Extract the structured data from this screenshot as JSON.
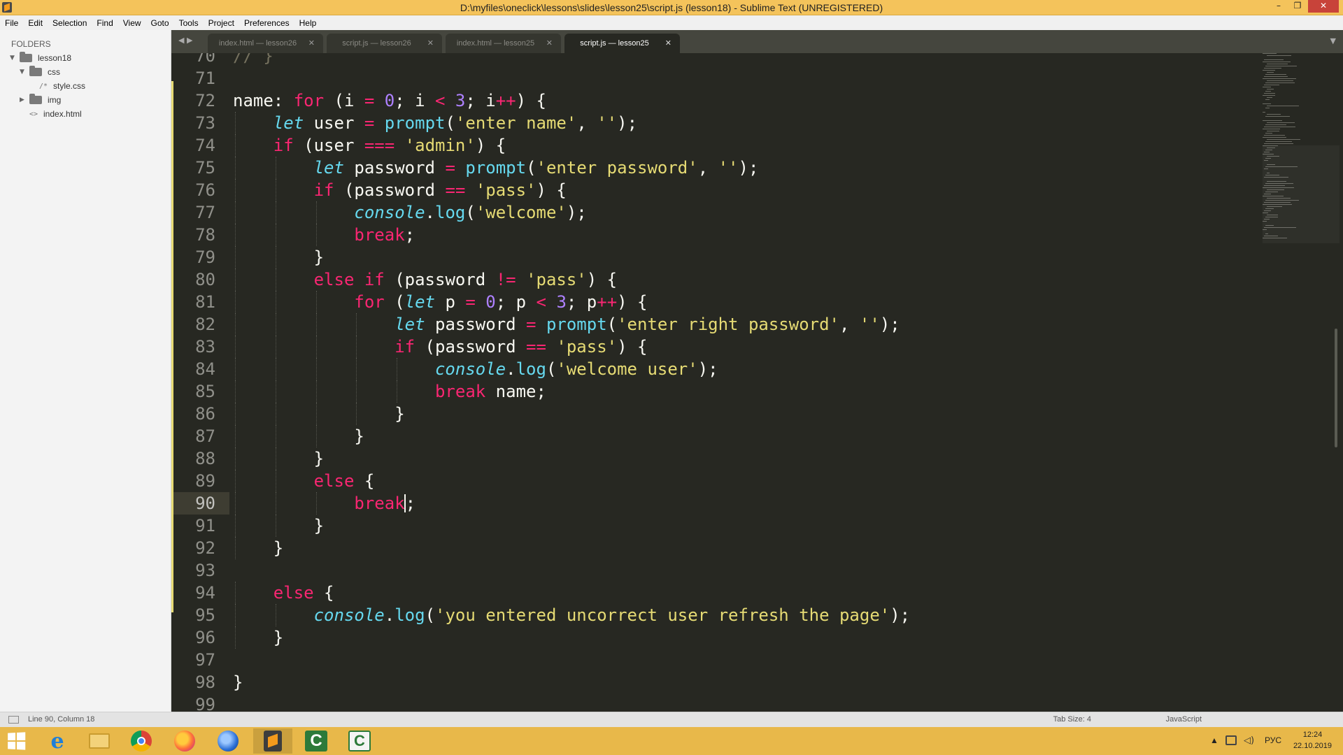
{
  "window": {
    "title": "D:\\myfiles\\oneclick\\lessons\\slides\\lesson25\\script.js (lesson18) - Sublime Text (UNREGISTERED)",
    "minimize_glyph": "–",
    "maximize_glyph": "❐",
    "close_glyph": "✕"
  },
  "menu": [
    "File",
    "Edit",
    "Selection",
    "Find",
    "View",
    "Goto",
    "Tools",
    "Project",
    "Preferences",
    "Help"
  ],
  "sidebar": {
    "heading": "FOLDERS",
    "tree": [
      {
        "label": "lesson18",
        "type": "folder",
        "expanded": true
      },
      {
        "label": "css",
        "type": "folder",
        "expanded": true
      },
      {
        "label": "style.css",
        "type": "file",
        "icon": "/*"
      },
      {
        "label": "img",
        "type": "folder",
        "expanded": false
      },
      {
        "label": "index.html",
        "type": "file",
        "icon": "<>"
      }
    ]
  },
  "tabs": [
    {
      "label": "index.html — lesson26",
      "active": false
    },
    {
      "label": "script.js — lesson26",
      "active": false
    },
    {
      "label": "index.html — lesson25",
      "active": false
    },
    {
      "label": "script.js — lesson25",
      "active": true
    }
  ],
  "tab_close_glyph": "✕",
  "tab_nav_glyph": "◀ ▶",
  "tab_dropdown_glyph": "▼",
  "editor": {
    "current_line": 90,
    "lines": [
      {
        "n": "70",
        "text": "// }"
      },
      {
        "n": "71",
        "text": ""
      },
      {
        "n": "72",
        "text": "name: for (i = 0; i < 3; i++) {"
      },
      {
        "n": "73",
        "text": "    let user = prompt('enter name', '');"
      },
      {
        "n": "74",
        "text": "    if (user === 'admin') {"
      },
      {
        "n": "75",
        "text": "        let password = prompt('enter password', '');"
      },
      {
        "n": "76",
        "text": "        if (password == 'pass') {"
      },
      {
        "n": "77",
        "text": "            console.log('welcome');"
      },
      {
        "n": "78",
        "text": "            break;"
      },
      {
        "n": "79",
        "text": "        }"
      },
      {
        "n": "80",
        "text": "        else if (password != 'pass') {"
      },
      {
        "n": "81",
        "text": "            for (let p = 0; p < 3; p++) {"
      },
      {
        "n": "82",
        "text": "                let password = prompt('enter right password', '');"
      },
      {
        "n": "83",
        "text": "                if (password == 'pass') {"
      },
      {
        "n": "84",
        "text": "                    console.log('welcome user');"
      },
      {
        "n": "85",
        "text": "                    break name;"
      },
      {
        "n": "86",
        "text": "                }"
      },
      {
        "n": "87",
        "text": "            }"
      },
      {
        "n": "88",
        "text": "        }"
      },
      {
        "n": "89",
        "text": "        else {"
      },
      {
        "n": "90",
        "text": "            break;"
      },
      {
        "n": "91",
        "text": "        }"
      },
      {
        "n": "92",
        "text": "    }"
      },
      {
        "n": "93",
        "text": ""
      },
      {
        "n": "94",
        "text": "    else {"
      },
      {
        "n": "95",
        "text": "        console.log('you entered uncorrect user refresh the page');"
      },
      {
        "n": "96",
        "text": "    }"
      },
      {
        "n": "97",
        "text": ""
      },
      {
        "n": "98",
        "text": "}"
      },
      {
        "n": "99",
        "text": ""
      }
    ]
  },
  "statusbar": {
    "position": "Line 90, Column 18",
    "tab_size": "Tab Size: 4",
    "syntax": "JavaScript"
  },
  "taskbar": {
    "apps": [
      "start-button",
      "internet-explorer",
      "file-explorer",
      "chrome",
      "firefox",
      "firefox-developer",
      "sublime-text",
      "camtasia-recorder",
      "camtasia-studio"
    ],
    "tray_arrow": "▲",
    "language": "РУС",
    "time": "12:24",
    "date": "22.10.2019"
  },
  "colors": {
    "titlebar": "#f4c35b",
    "taskbar": "#e8b84a",
    "editor_bg": "#272822",
    "keyword": "#f92672",
    "storage": "#66d9ef",
    "string": "#e6db74",
    "number": "#ae81ff",
    "comment": "#75715e"
  }
}
